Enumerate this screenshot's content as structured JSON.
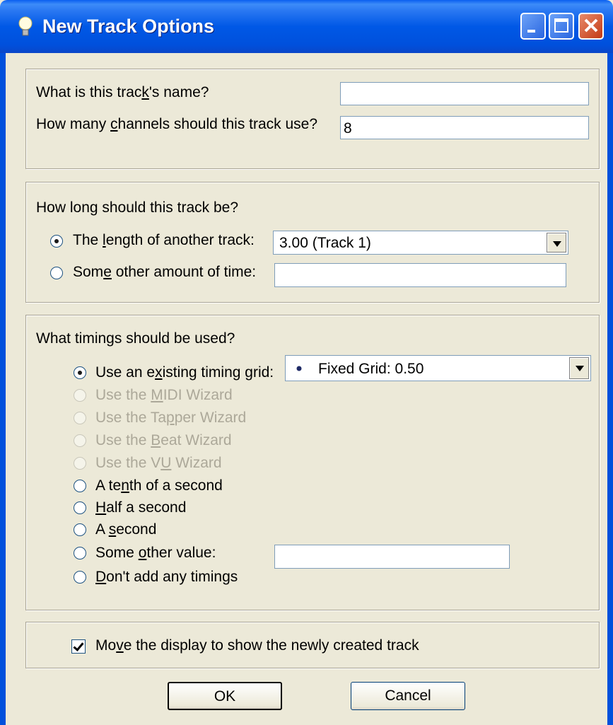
{
  "window": {
    "title": "New Track Options"
  },
  "section1": {
    "name_label_pre": "What is this trac",
    "name_label_u": "k",
    "name_label_post": "'s name?",
    "name_value": "",
    "channels_label_pre": "How many ",
    "channels_label_u": "c",
    "channels_label_post": "hannels should this track use?",
    "channels_value": "8"
  },
  "section2": {
    "heading": "How long should this track be?",
    "opt1_pre": "The ",
    "opt1_u": "l",
    "opt1_post": "ength of another track:",
    "opt1_combo": "3.00 (Track 1)",
    "opt2_pre": "Som",
    "opt2_u": "e",
    "opt2_post": " other amount of time:",
    "opt2_value": ""
  },
  "section3": {
    "heading": "What timings should be used?",
    "grid_pre": "Use an e",
    "grid_u": "x",
    "grid_post": "isting timing grid:",
    "grid_combo": "Fixed Grid: 0.50",
    "midi_pre": "Use the ",
    "midi_u": "M",
    "midi_post": "IDI Wizard",
    "tapper_pre": "Use the Ta",
    "tapper_u": "p",
    "tapper_post": "per Wizard",
    "beat_pre": "Use the ",
    "beat_u": "B",
    "beat_post": "eat Wizard",
    "vu_pre": "Use the V",
    "vu_u": "U",
    "vu_post": " Wizard",
    "tenth_pre": "A te",
    "tenth_u": "n",
    "tenth_post": "th of a second",
    "half_pre": "",
    "half_u": "H",
    "half_post": "alf a second",
    "second_pre": "A ",
    "second_u": "s",
    "second_post": "econd",
    "other_pre": "Some ",
    "other_u": "o",
    "other_post": "ther value:",
    "other_value": "",
    "none_pre": "",
    "none_u": "D",
    "none_post": "on't add any timings"
  },
  "section4": {
    "move_pre": "Mo",
    "move_u": "v",
    "move_post": "e the display to show the newly created track",
    "move_checked": true
  },
  "buttons": {
    "ok": "OK",
    "cancel": "Cancel"
  }
}
